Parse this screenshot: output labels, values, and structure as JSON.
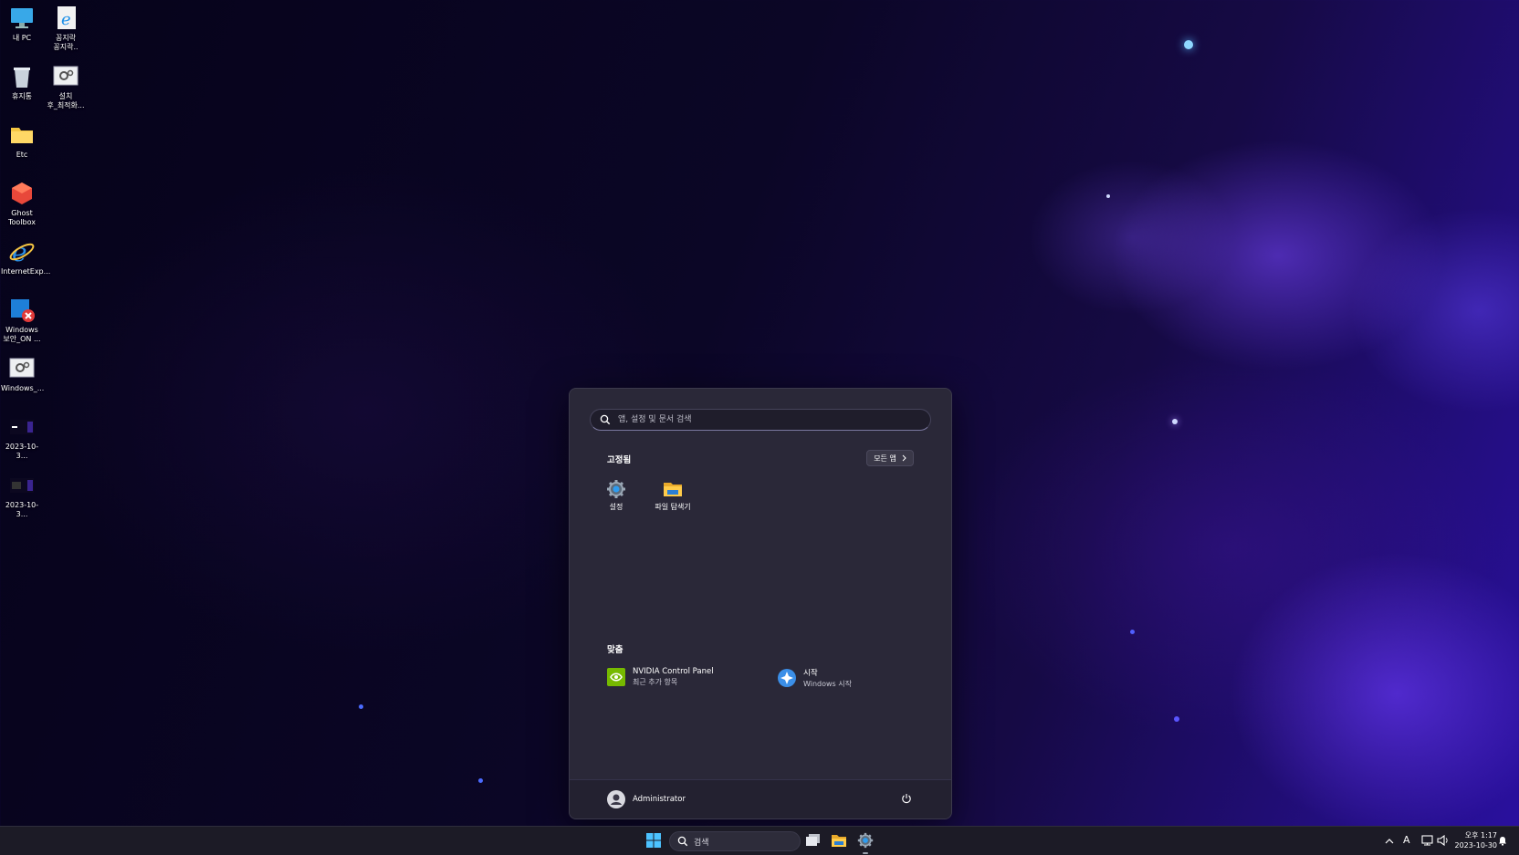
{
  "desktop": {
    "icons": [
      {
        "label": "내 PC",
        "icon": "monitor-icon"
      },
      {
        "label": "꽁지락\n꽁지락..",
        "icon": "ie-shortcut-icon"
      },
      {
        "label": "휴지통",
        "icon": "recycle-bin-icon"
      },
      {
        "label": "설치\n후_최적화...",
        "icon": "settings-file-icon"
      },
      {
        "label": "Etc",
        "icon": "folder-icon"
      },
      {
        "label": "Ghost\nToolbox",
        "icon": "ghost-toolbox-icon"
      },
      {
        "label": "InternetExp...",
        "icon": "internet-explorer-icon"
      },
      {
        "label": "Windows\n보안_ON ...",
        "icon": "windows-security-icon"
      },
      {
        "label": "Windows_...",
        "icon": "settings-file-icon"
      },
      {
        "label": "2023-10-3...",
        "icon": "screenshot-icon"
      },
      {
        "label": "2023-10-3...",
        "icon": "screenshot-icon"
      }
    ]
  },
  "start_menu": {
    "search_placeholder": "앱, 설정 및 문서 검색",
    "pinned_title": "고정됨",
    "all_apps_label": "모든 앱",
    "pinned": [
      {
        "label": "설정",
        "icon": "settings-gear-icon"
      },
      {
        "label": "파일 탐색기",
        "icon": "file-explorer-icon"
      }
    ],
    "recommended_title": "맞춤",
    "recommended": [
      {
        "title": "NVIDIA Control Panel",
        "subtitle": "최근 추가 항목",
        "icon": "nvidia-icon"
      },
      {
        "title": "시작",
        "subtitle": "Windows 시작",
        "icon": "get-started-icon"
      }
    ],
    "user_name": "Administrator"
  },
  "taskbar": {
    "search_label": "검색",
    "ime_indicator": "A",
    "clock_time": "오후 1:17",
    "clock_date": "2023-10-30"
  },
  "colors": {
    "start_bg": "#2a2838",
    "taskbar_bg": "#1c1b26",
    "accent": "#4cc2ff"
  }
}
